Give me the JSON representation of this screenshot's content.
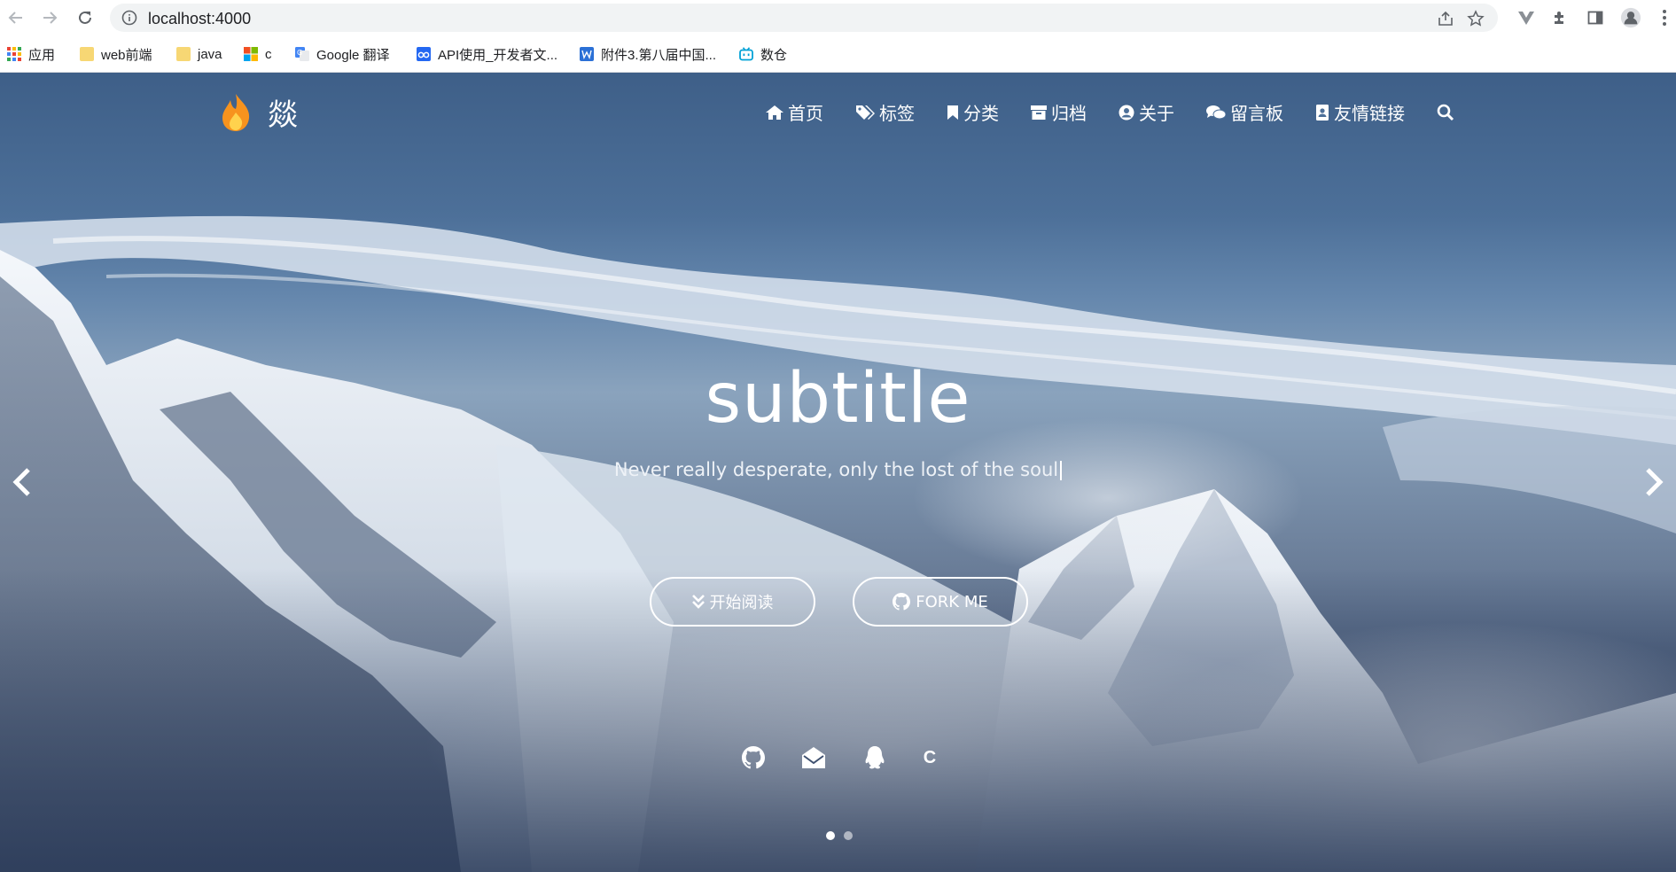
{
  "browser": {
    "url": "localhost:4000",
    "bookmarks": [
      {
        "label": "应用",
        "icon": "apps-grid-icon"
      },
      {
        "label": "web前端",
        "icon": "folder-icon"
      },
      {
        "label": "java",
        "icon": "folder-icon"
      },
      {
        "label": "c",
        "icon": "windows-logo-icon"
      },
      {
        "label": "Google 翻译",
        "icon": "google-translate-icon"
      },
      {
        "label": "API使用_开发者文...",
        "icon": "api-docs-icon"
      },
      {
        "label": "附件3.第八届中国...",
        "icon": "word-doc-icon"
      },
      {
        "label": "数仓",
        "icon": "bilibili-icon"
      }
    ]
  },
  "site": {
    "logo_text": "燚",
    "nav": [
      {
        "label": "首页",
        "icon": "home-icon"
      },
      {
        "label": "标签",
        "icon": "tags-icon"
      },
      {
        "label": "分类",
        "icon": "bookmark-icon"
      },
      {
        "label": "归档",
        "icon": "archive-icon"
      },
      {
        "label": "关于",
        "icon": "user-circle-icon"
      },
      {
        "label": "留言板",
        "icon": "comments-icon"
      },
      {
        "label": "友情链接",
        "icon": "address-book-icon"
      }
    ],
    "search_icon": "search-icon"
  },
  "hero": {
    "title": "subtitle",
    "subtitle": "Never really desperate, only the lost of the soul",
    "read_button": "开始阅读",
    "fork_button": "FORK ME",
    "social_c": "C",
    "slides_total": 2,
    "active_slide": 1
  },
  "colors": {
    "sky_top": "#3e5f88",
    "snow": "#eef2f7",
    "text": "#ffffff"
  }
}
